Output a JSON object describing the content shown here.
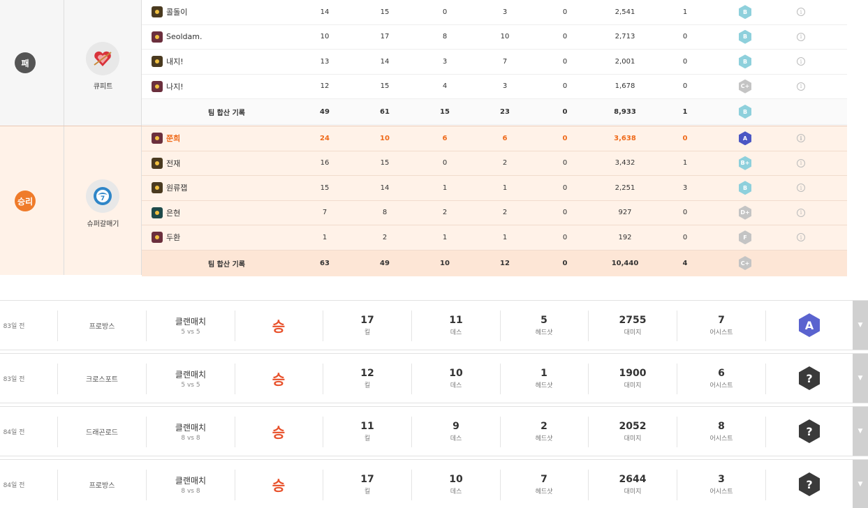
{
  "teams": [
    {
      "result": "패",
      "clan_name": "큐피트",
      "logo_icon": "heart-logo-icon",
      "players": [
        {
          "name": "콜돌이",
          "rank": "b",
          "kills": "14",
          "deaths": "15",
          "headshots": "0",
          "assists_col": "3",
          "c5": "0",
          "damage": "2,541",
          "c7": "1",
          "grade": "B",
          "grade_color": "g-blue"
        },
        {
          "name": "Seoldam.",
          "rank": "a",
          "kills": "10",
          "deaths": "17",
          "headshots": "8",
          "assists_col": "10",
          "c5": "0",
          "damage": "2,713",
          "c7": "0",
          "grade": "B",
          "grade_color": "g-blue"
        },
        {
          "name": "내지!",
          "rank": "b",
          "kills": "13",
          "deaths": "14",
          "headshots": "3",
          "assists_col": "7",
          "c5": "0",
          "damage": "2,001",
          "c7": "0",
          "grade": "B",
          "grade_color": "g-blue"
        },
        {
          "name": "나지!",
          "rank": "a",
          "kills": "12",
          "deaths": "15",
          "headshots": "4",
          "assists_col": "3",
          "c5": "0",
          "damage": "1,678",
          "c7": "0",
          "grade": "C+",
          "grade_color": "g-gray"
        }
      ],
      "total": {
        "label": "팀 합산 기록",
        "kills": "49",
        "deaths": "61",
        "headshots": "15",
        "assists_col": "23",
        "c5": "0",
        "damage": "8,933",
        "c7": "1",
        "grade": "B",
        "grade_color": "g-blue"
      }
    },
    {
      "result": "승리",
      "clan_name": "슈퍼갈매기",
      "logo_icon": "seagull-logo-icon",
      "players": [
        {
          "name": "쭌희",
          "rank": "a",
          "highlight": true,
          "kills": "24",
          "deaths": "10",
          "headshots": "6",
          "assists_col": "6",
          "c5": "0",
          "damage": "3,638",
          "c7": "0",
          "grade": "A",
          "grade_color": "g-a"
        },
        {
          "name": "전재",
          "rank": "b",
          "kills": "16",
          "deaths": "15",
          "headshots": "0",
          "assists_col": "2",
          "c5": "0",
          "damage": "3,432",
          "c7": "1",
          "grade": "B+",
          "grade_color": "g-blue"
        },
        {
          "name": "원류잽",
          "rank": "b",
          "kills": "15",
          "deaths": "14",
          "headshots": "1",
          "assists_col": "1",
          "c5": "0",
          "damage": "2,251",
          "c7": "3",
          "grade": "B",
          "grade_color": "g-blue"
        },
        {
          "name": "은현",
          "rank": "c",
          "kills": "7",
          "deaths": "8",
          "headshots": "2",
          "assists_col": "2",
          "c5": "0",
          "damage": "927",
          "c7": "0",
          "grade": "D+",
          "grade_color": "g-gray"
        },
        {
          "name": "두환",
          "rank": "a",
          "kills": "1",
          "deaths": "2",
          "headshots": "1",
          "assists_col": "1",
          "c5": "0",
          "damage": "192",
          "c7": "0",
          "grade": "F",
          "grade_color": "g-gray"
        }
      ],
      "total": {
        "label": "팀 합산 기록",
        "kills": "63",
        "deaths": "49",
        "headshots": "10",
        "assists_col": "12",
        "c5": "0",
        "damage": "10,440",
        "c7": "4",
        "grade": "C+",
        "grade_color": "g-gray"
      }
    }
  ],
  "info_glyph": "i",
  "labels": {
    "kill": "킬",
    "death": "데스",
    "headshot": "헤드샷",
    "damage": "대미지",
    "assist": "어시스트"
  },
  "expand_glyph": "▼",
  "matches": [
    {
      "date": "83일 전",
      "map": "프로방스",
      "mode": "클랜매치",
      "vs": "5 vs 5",
      "result": "승",
      "kills": "17",
      "deaths": "11",
      "headshots": "5",
      "damage": "2755",
      "assists": "7",
      "grade": "A",
      "grade_type": "a"
    },
    {
      "date": "83일 전",
      "map": "크로스포트",
      "mode": "클랜매치",
      "vs": "5 vs 5",
      "result": "승",
      "kills": "12",
      "deaths": "10",
      "headshots": "1",
      "damage": "1900",
      "assists": "6",
      "grade": "?",
      "grade_type": "q"
    },
    {
      "date": "84일 전",
      "map": "드래곤로드",
      "mode": "클랜매치",
      "vs": "8 vs 8",
      "result": "승",
      "kills": "11",
      "deaths": "9",
      "headshots": "2",
      "damage": "2052",
      "assists": "8",
      "grade": "?",
      "grade_type": "q"
    },
    {
      "date": "84일 전",
      "map": "프로방스",
      "mode": "클랜매치",
      "vs": "8 vs 8",
      "result": "승",
      "kills": "17",
      "deaths": "10",
      "headshots": "7",
      "damage": "2644",
      "assists": "3",
      "grade": "?",
      "grade_type": "q"
    }
  ]
}
